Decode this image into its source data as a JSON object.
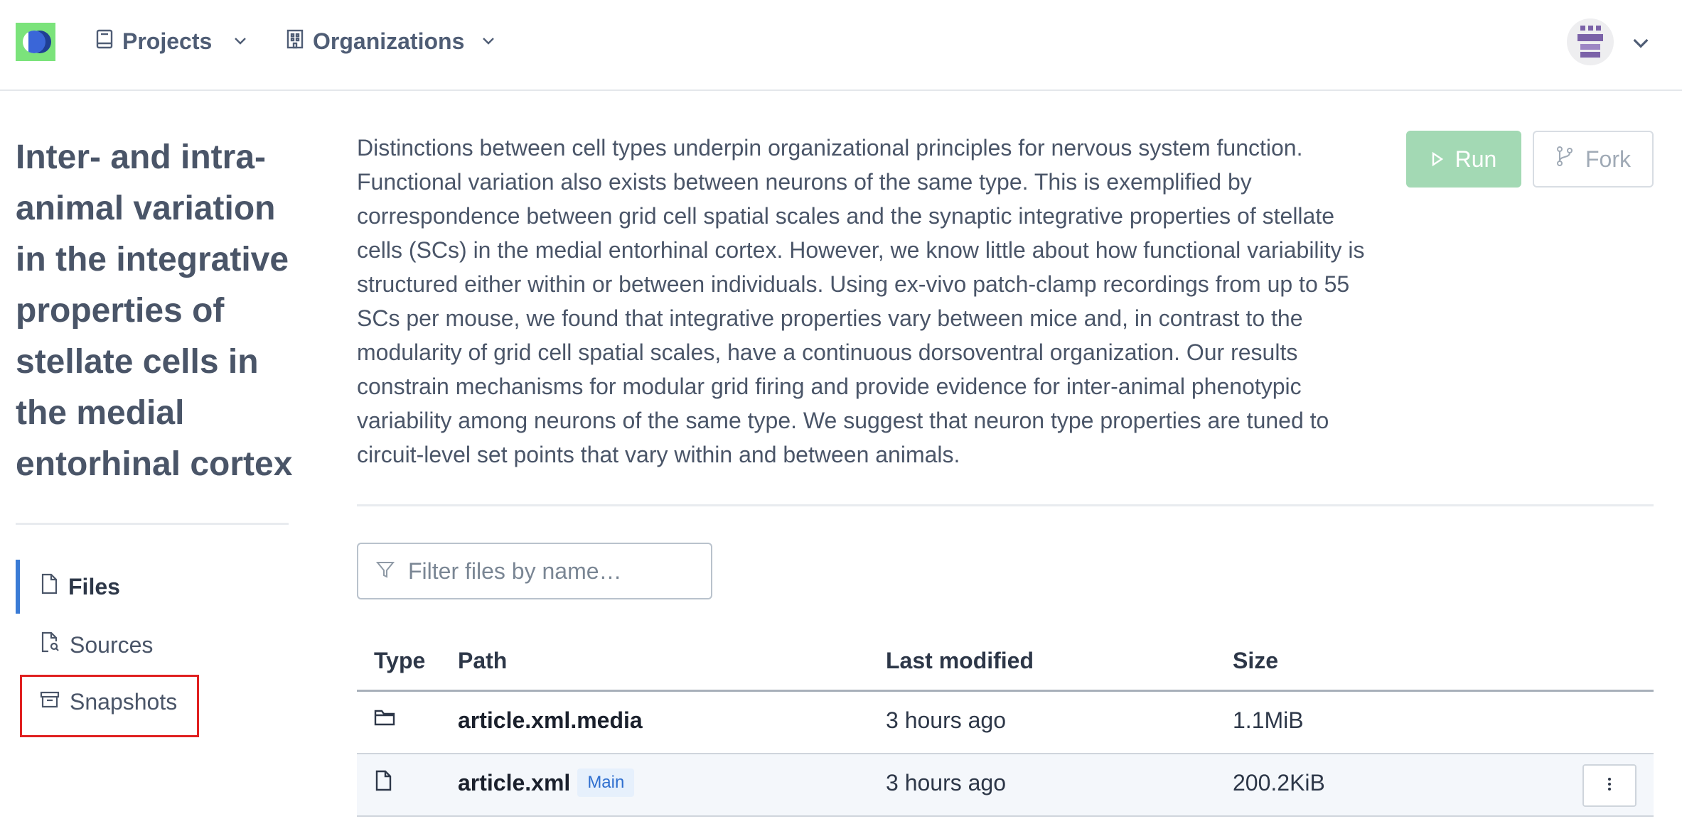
{
  "header": {
    "logo_icon": "app-logo-icon",
    "nav": [
      {
        "label": "Projects",
        "icon": "book-icon"
      },
      {
        "label": "Organizations",
        "icon": "building-icon"
      }
    ],
    "avatar_icon": "user-avatar-icon"
  },
  "project": {
    "title": "Inter- and intra-animal variation in the integrative properties of stellate cells in the medial entorhinal cortex",
    "description": "Distinctions between cell types underpin organizational principles for nervous system function. Functional variation also exists between neurons of the same type. This is exemplified by correspondence between grid cell spatial scales and the synaptic integrative properties of stellate cells (SCs) in the medial entorhinal cortex. However, we know little about how functional variability is structured either within or between individuals. Using ex-vivo patch-clamp recordings from up to 55 SCs per mouse, we found that integrative properties vary between mice and, in contrast to the modularity of grid cell spatial scales, have a continuous dorsoventral organization. Our results constrain mechanisms for modular grid firing and provide evidence for inter-animal phenotypic variability among neurons of the same type. We suggest that neuron type properties are tuned to circuit-level set points that vary within and between animals."
  },
  "actions": {
    "run_label": "Run",
    "fork_label": "Fork"
  },
  "sidebar": {
    "items": [
      {
        "label": "Files",
        "icon": "file-icon",
        "active": true
      },
      {
        "label": "Sources",
        "icon": "file-search-icon",
        "active": false
      },
      {
        "label": "Snapshots",
        "icon": "archive-icon",
        "active": false
      }
    ]
  },
  "filter": {
    "placeholder": "Filter files by name…",
    "value": ""
  },
  "table": {
    "headers": {
      "type": "Type",
      "path": "Path",
      "modified": "Last modified",
      "size": "Size"
    },
    "rows": [
      {
        "type": "folder",
        "path": "article.xml.media",
        "badge": "",
        "modified": "3 hours ago",
        "size": "1.1MiB"
      },
      {
        "type": "file",
        "path": "article.xml",
        "badge": "Main",
        "modified": "3 hours ago",
        "size": "200.2KiB"
      }
    ]
  },
  "colors": {
    "run_button": "#a3d9b4",
    "active_accent": "#3a7bd5",
    "highlight": "#e02020",
    "logo_bg": "#7be37b"
  }
}
